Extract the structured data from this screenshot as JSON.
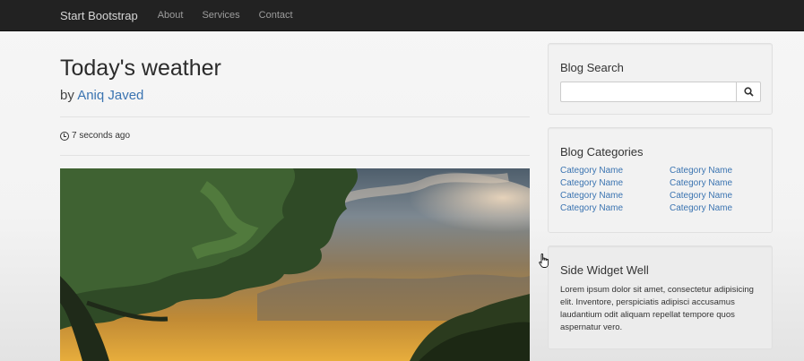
{
  "navbar": {
    "brand": "Start Bootstrap",
    "links": [
      "About",
      "Services",
      "Contact"
    ]
  },
  "post": {
    "title": "Today's weather",
    "by_prefix": "by",
    "author": "Aniq Javed",
    "posted": "7 seconds ago",
    "clock_icon": "clock-icon"
  },
  "sidebar": {
    "search": {
      "title": "Blog Search",
      "value": "",
      "placeholder": "",
      "button_icon": "search-icon"
    },
    "categories": {
      "title": "Blog Categories",
      "left": [
        "Category Name",
        "Category Name",
        "Category Name",
        "Category Name"
      ],
      "right": [
        "Category Name",
        "Category Name",
        "Category Name",
        "Category Name"
      ]
    },
    "widget": {
      "title": "Side Widget Well",
      "text": "Lorem ipsum dolor sit amet, consectetur adipisicing elit. Inventore, perspiciatis adipisci accusamus laudantium odit aliquam repellat tempore quos aspernatur vero."
    }
  },
  "colors": {
    "navbar_bg": "#222222",
    "link": "#3b74b1",
    "page_bg": "#f6f6f6"
  }
}
